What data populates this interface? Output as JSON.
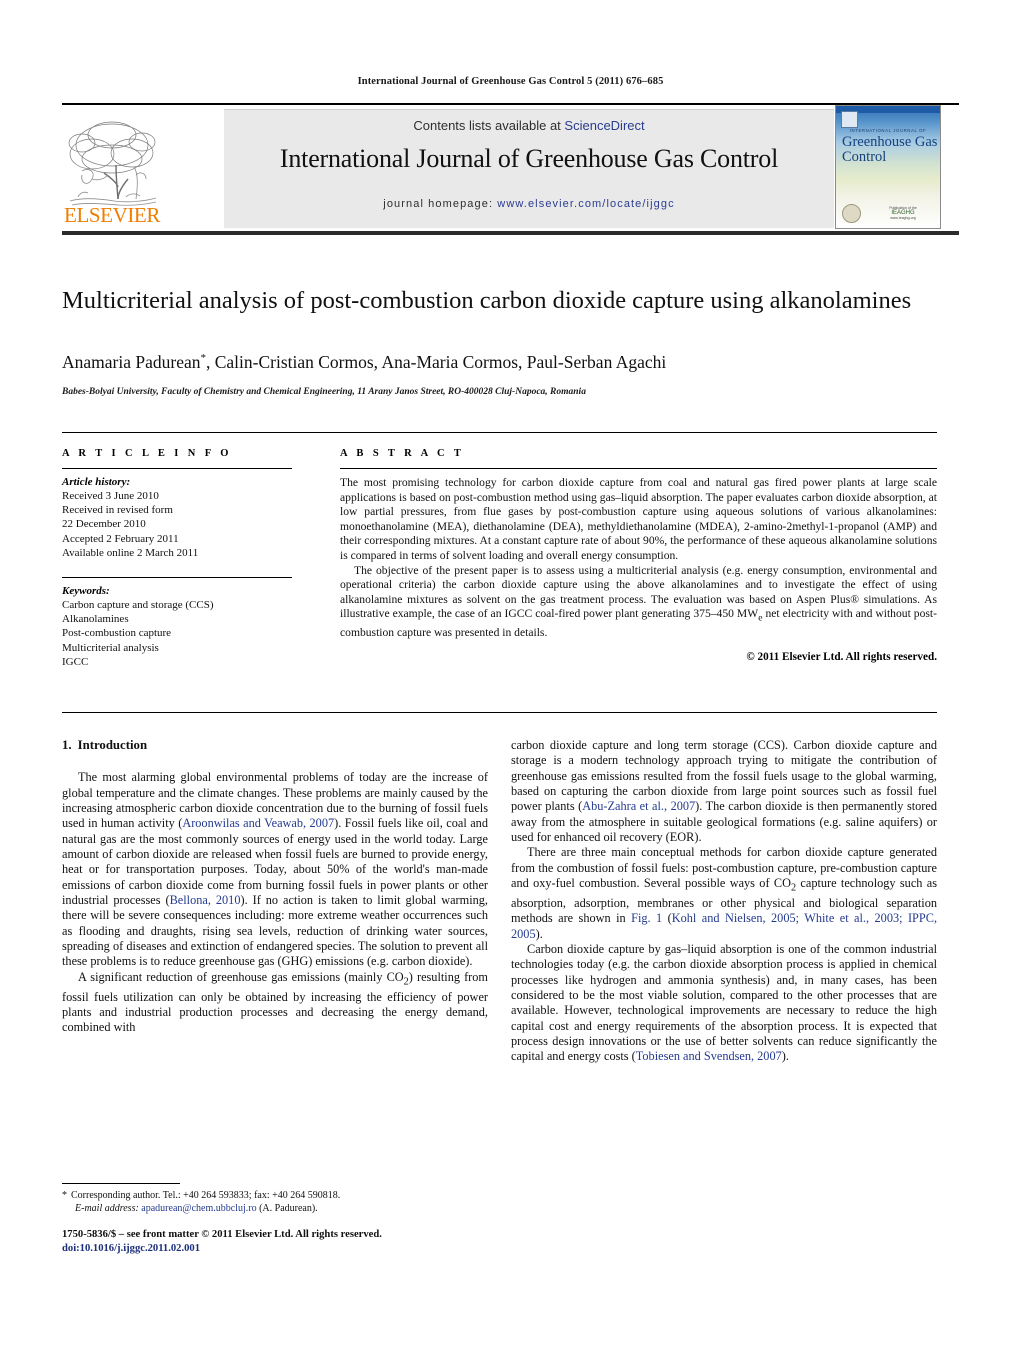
{
  "running_head": "International Journal of Greenhouse Gas Control 5 (2011) 676–685",
  "masthead": {
    "contents_label": "Contents lists available at",
    "sciencedirect": "ScienceDirect",
    "journal_title": "International Journal of Greenhouse Gas Control",
    "homepage_label": "journal homepage:",
    "homepage_url": "www.elsevier.com/locate/ijggc",
    "publisher_logo_text": "ELSEVIER",
    "cover": {
      "supertitle": "INTERNATIONAL JOURNAL OF",
      "title": "Greenhouse Gas Control",
      "foot_line1": "Publication of the",
      "foot_brand": "IEAGHG",
      "foot_line2": "www.ieaghg.org"
    }
  },
  "article": {
    "title": "Multicriterial analysis of post-combustion carbon dioxide capture using alkanolamines",
    "authors": "Anamaria Padurean",
    "authors_rest": ", Calin-Cristian Cormos, Ana-Maria Cormos, Paul-Serban Agachi",
    "author_marker": "*",
    "affiliation": "Babes-Bolyai University, Faculty of Chemistry and Chemical Engineering, 11 Arany Janos Street, RO-400028 Cluj-Napoca, Romania"
  },
  "info": {
    "heading": "A R T I C L E   I N F O",
    "history_label": "Article history:",
    "history": [
      "Received 3 June 2010",
      "Received in revised form",
      "22 December 2010",
      "Accepted 2 February 2011",
      "Available online 2 March 2011"
    ],
    "keywords_label": "Keywords:",
    "keywords": [
      "Carbon capture and storage (CCS)",
      "Alkanolamines",
      "Post-combustion capture",
      "Multicriterial analysis",
      "IGCC"
    ]
  },
  "abstract": {
    "heading": "A B S T R A C T",
    "paragraph1": "The most promising technology for carbon dioxide capture from coal and natural gas fired power plants at large scale applications is based on post-combustion method using gas–liquid absorption. The paper evaluates carbon dioxide absorption, at low partial pressures, from flue gases by post-combustion capture using aqueous solutions of various alkanolamines: monoethanolamine (MEA), diethanolamine (DEA), methyldiethanolamine (MDEA), 2-amino-2methyl-1-propanol (AMP) and their corresponding mixtures. At a constant capture rate of about 90%, the performance of these aqueous alkanolamine solutions is compared in terms of solvent loading and overall energy consumption.",
    "paragraph2_a": "The objective of the present paper is to assess using a multicriterial analysis (e.g. energy consumption, environmental and operational criteria) the carbon dioxide capture using the above alkanolamines and to investigate the effect of using alkanolamine mixtures as solvent on the gas treatment process. The evaluation was based on Aspen Plus® simulations. As illustrative example, the case of an IGCC coal-fired power plant generating 375–450 MW",
    "paragraph2_sub": "e",
    "paragraph2_b": " net electricity with and without post-combustion capture was presented in details.",
    "copyright": "© 2011 Elsevier Ltd. All rights reserved."
  },
  "body": {
    "section_number": "1.",
    "section_title": "Introduction",
    "left": {
      "p1_a": "The most alarming global environmental problems of today are the increase of global temperature and the climate changes. These problems are mainly caused by the increasing atmospheric carbon dioxide concentration due to the burning of fossil fuels used in human activity (",
      "p1_cite1": "Aroonwilas and Veawab, 2007",
      "p1_b": "). Fossil fuels like oil, coal and natural gas are the most commonly sources of energy used in the world today. Large amount of carbon dioxide are released when fossil fuels are burned to provide energy, heat or for transportation purposes. Today, about 50% of the world's man-made emissions of carbon dioxide come from burning fossil fuels in power plants or other industrial processes (",
      "p1_cite2": "Bellona, 2010",
      "p1_c": "). If no action is taken to limit global warming, there will be severe consequences including: more extreme weather occurrences such as flooding and draughts, rising sea levels, reduction of drinking water sources, spreading of diseases and extinction of endangered species. The solution to prevent all these problems is to reduce greenhouse gas (GHG) emissions (e.g. carbon dioxide).",
      "p2_a": "A significant reduction of greenhouse gas emissions (mainly CO",
      "p2_sub": "2",
      "p2_b": ") resulting from fossil fuels utilization can only be obtained by increasing the efficiency of power plants and industrial production processes and decreasing the energy demand, combined with"
    },
    "right": {
      "p1_a": "carbon dioxide capture and long term storage (CCS). Carbon dioxide capture and storage is a modern technology approach trying to mitigate the contribution of greenhouse gas emissions resulted from the fossil fuels usage to the global warming, based on capturing the carbon dioxide from large point sources such as fossil fuel power plants (",
      "p1_cite1": "Abu-Zahra et al., 2007",
      "p1_b": "). The carbon dioxide is then permanently stored away from the atmosphere in suitable geological formations (e.g. saline aquifers) or used for enhanced oil recovery (EOR).",
      "p2_a": "There are three main conceptual methods for carbon dioxide capture generated from the combustion of fossil fuels: post-combustion capture, pre-combustion capture and oxy-fuel combustion. Several possible ways of CO",
      "p2_sub": "2",
      "p2_b": " capture technology such as absorption, adsorption, membranes or other physical and biological separation methods are shown in ",
      "p2_figref": "Fig. 1",
      "p2_c": " (",
      "p2_cite": "Kohl and Nielsen, 2005; White et al., 2003; IPPC, 2005",
      "p2_d": ").",
      "p3_a": "Carbon dioxide capture by gas–liquid absorption is one of the common industrial technologies today (e.g. the carbon dioxide absorption process is applied in chemical processes like hydrogen and ammonia synthesis) and, in many cases, has been considered to be the most viable solution, compared to the other processes that are available. However, technological improvements are necessary to reduce the high capital cost and energy requirements of the absorption process. It is expected that process design innovations or the use of better solvents can reduce significantly the capital and energy costs (",
      "p3_cite": "Tobiesen and Svendsen, 2007",
      "p3_b": ")."
    }
  },
  "footnote": {
    "marker": "*",
    "line1": "Corresponding author. Tel.: +40 264 593833; fax: +40 264 590818.",
    "email_label": "E-mail address:",
    "email": "apadurean@chem.ubbcluj.ro",
    "email_suffix": "(A. Padurean)."
  },
  "page_footer": {
    "issn_line": "1750-5836/$ – see front matter © 2011 Elsevier Ltd. All rights reserved.",
    "doi": "doi:10.1016/j.ijggc.2011.02.001"
  }
}
